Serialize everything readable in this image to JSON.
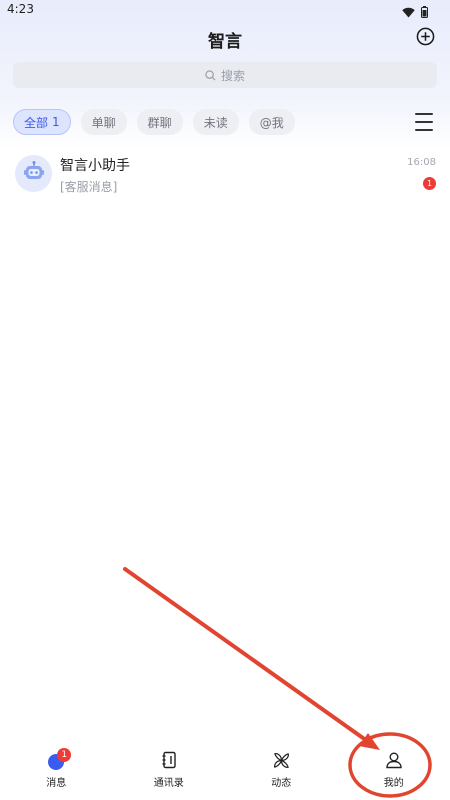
{
  "status_bar": {
    "time": "4:23"
  },
  "header": {
    "title": "智言"
  },
  "search": {
    "placeholder": "搜索"
  },
  "filters": {
    "tabs": [
      {
        "label": "全部",
        "count": "1",
        "active": true
      },
      {
        "label": "单聊"
      },
      {
        "label": "群聊"
      },
      {
        "label": "未读"
      },
      {
        "label": "@我"
      }
    ]
  },
  "conversations": [
    {
      "name": "智言小助手",
      "preview": "[客服消息]",
      "time": "16:08",
      "unread": "1"
    }
  ],
  "bottom_nav": {
    "items": [
      {
        "label": "消息",
        "badge": "1"
      },
      {
        "label": "通讯录"
      },
      {
        "label": "动态"
      },
      {
        "label": "我的"
      }
    ]
  },
  "colors": {
    "accent": "#3a5df0",
    "badge": "#ee3b35",
    "annotation": "#e2452f"
  }
}
